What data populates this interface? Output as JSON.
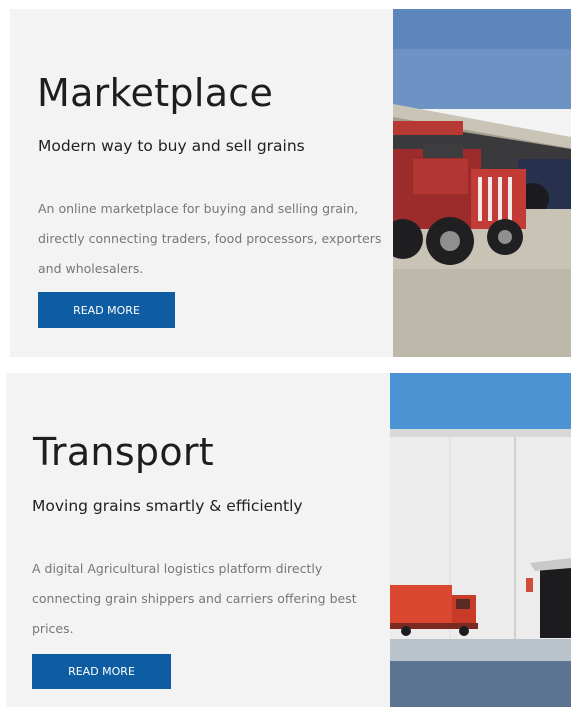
{
  "cards": [
    {
      "title": "Marketplace",
      "subtitle": "Modern way to buy and sell grains",
      "description": "An online marketplace for buying and selling grain, directly connecting traders, food processors, exporters and wholesalers.",
      "button_label": "READ MORE",
      "image_subject": "red tractor under warehouse shed"
    },
    {
      "title": "Transport",
      "subtitle": "Moving grains smartly & efficiently",
      "description": "A digital Agricultural logistics platform directly connecting grain shippers and carriers offering best prices.",
      "button_label": "READ MORE",
      "image_subject": "red truck beside white warehouse"
    }
  ],
  "colors": {
    "card_background": "#f3f3f4",
    "button": "#0e5da3",
    "button_text": "#ffffff",
    "description_text": "#777777"
  }
}
